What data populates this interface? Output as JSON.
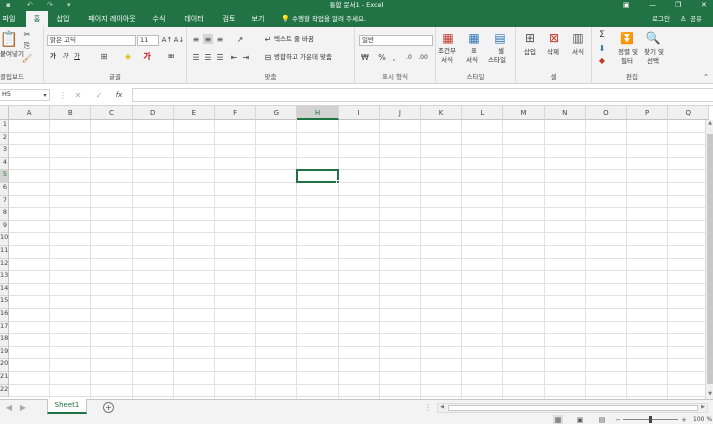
{
  "window": {
    "title": "통합 문서1 - Excel",
    "login": "로그인",
    "share": "공유",
    "accent": "#217346"
  },
  "tabs": [
    {
      "label": "파일"
    },
    {
      "label": "홈"
    },
    {
      "label": "삽입"
    },
    {
      "label": "페이지 레이아웃"
    },
    {
      "label": "수식"
    },
    {
      "label": "데이터"
    },
    {
      "label": "검토"
    },
    {
      "label": "보기"
    }
  ],
  "tell_me": "수행할 작업을 알려 주세요.",
  "ribbon": {
    "clipboard": {
      "paste": "붙여넣기",
      "label": "클립보드"
    },
    "font": {
      "name": "맑은 고딕",
      "size": "11",
      "bold": "가",
      "italic": "가",
      "underline": "가",
      "label": "글꼴"
    },
    "alignment": {
      "wrap_text": "텍스트 줄 바꿈",
      "merge_center": "병합하고 가운데 맞춤",
      "label": "맞춤"
    },
    "number": {
      "format": "일반",
      "label": "표시 형식"
    },
    "styles": {
      "conditional_line1": "조건부",
      "conditional_line2": "서식",
      "table_line1": "표",
      "table_line2": "서식",
      "cell_line1": "셀",
      "cell_line2": "스타일",
      "label": "스타일"
    },
    "cells": {
      "insert": "삽입",
      "delete": "삭제",
      "format": "서식",
      "label": "셀"
    },
    "editing": {
      "sort_line1": "정렬 및",
      "sort_line2": "필터",
      "find_line1": "찾기 및",
      "find_line2": "선택",
      "label": "편집"
    }
  },
  "formula_bar": {
    "name_box": "H5",
    "fx": "fx",
    "value": ""
  },
  "grid": {
    "columns": [
      "A",
      "B",
      "C",
      "D",
      "E",
      "F",
      "G",
      "H",
      "I",
      "J",
      "K",
      "L",
      "M",
      "N",
      "O",
      "P",
      "Q"
    ],
    "rows": [
      "1",
      "2",
      "3",
      "4",
      "5",
      "6",
      "7",
      "8",
      "9",
      "10",
      "11",
      "12",
      "13",
      "14",
      "15",
      "16",
      "17",
      "18",
      "19",
      "20",
      "21",
      "22"
    ],
    "selected_cell": "H5"
  },
  "sheets": [
    {
      "label": "Sheet1"
    }
  ],
  "status": {
    "zoom": "100 %"
  }
}
